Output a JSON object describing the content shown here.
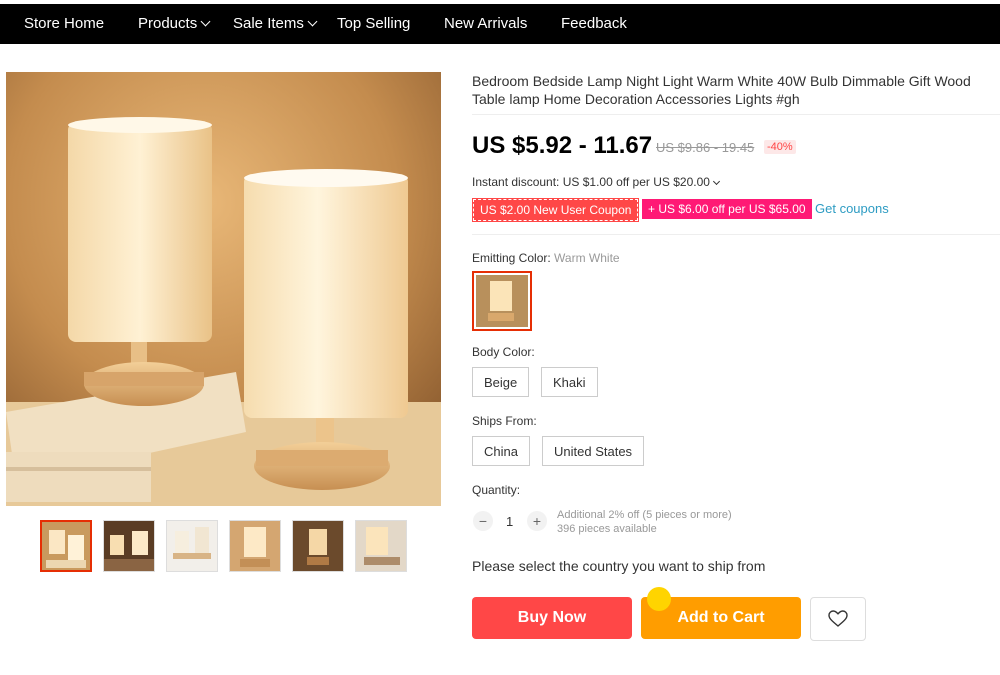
{
  "nav": {
    "items": [
      {
        "label": "Store Home",
        "dropdown": false
      },
      {
        "label": "Products",
        "dropdown": true
      },
      {
        "label": "Sale Items",
        "dropdown": true
      },
      {
        "label": "Top Selling",
        "dropdown": false
      },
      {
        "label": "New Arrivals",
        "dropdown": false
      },
      {
        "label": "Feedback",
        "dropdown": false
      }
    ]
  },
  "gallery": {
    "thumbnail_count": 6,
    "active_thumbnail": 1
  },
  "product": {
    "title": "Bedroom Bedside Lamp Night Light Warm White 40W Bulb Dimmable Gift Wood Table lamp Home Decoration Accessories Lights #gh",
    "price": "US $5.92 - 11.67",
    "original_price": "US $9.86 - 19.45",
    "discount": "-40%",
    "instant_discount": "Instant discount: US $1.00 off per US $20.00",
    "coupons": [
      {
        "label": "US $2.00 New User Coupon"
      },
      {
        "label": "+ US $6.00 off per US $65.00"
      }
    ],
    "get_coupons": "Get coupons"
  },
  "options": {
    "emitting_color_label": "Emitting Color:",
    "emitting_color_value": "Warm White",
    "body_color_label": "Body Color:",
    "body_colors": [
      "Beige",
      "Khaki"
    ],
    "ships_from_label": "Ships From:",
    "ships_from": [
      "China",
      "United States"
    ]
  },
  "quantity": {
    "label": "Quantity:",
    "value": "1",
    "minus": "−",
    "plus": "+",
    "additional": "Additional 2% off (5 pieces or more)",
    "available": "396 pieces available"
  },
  "ship_country_prompt": "Please select the country you want to ship from",
  "actions": {
    "buy_now": "Buy Now",
    "add_to_cart": "Add to Cart"
  },
  "colors": {
    "accent_red": "#ff4747",
    "accent_orange": "#ff9d00",
    "link_blue": "#2e9cc3",
    "nav_bg": "#000000"
  },
  "icons": {
    "wishlist": "heart-icon"
  }
}
